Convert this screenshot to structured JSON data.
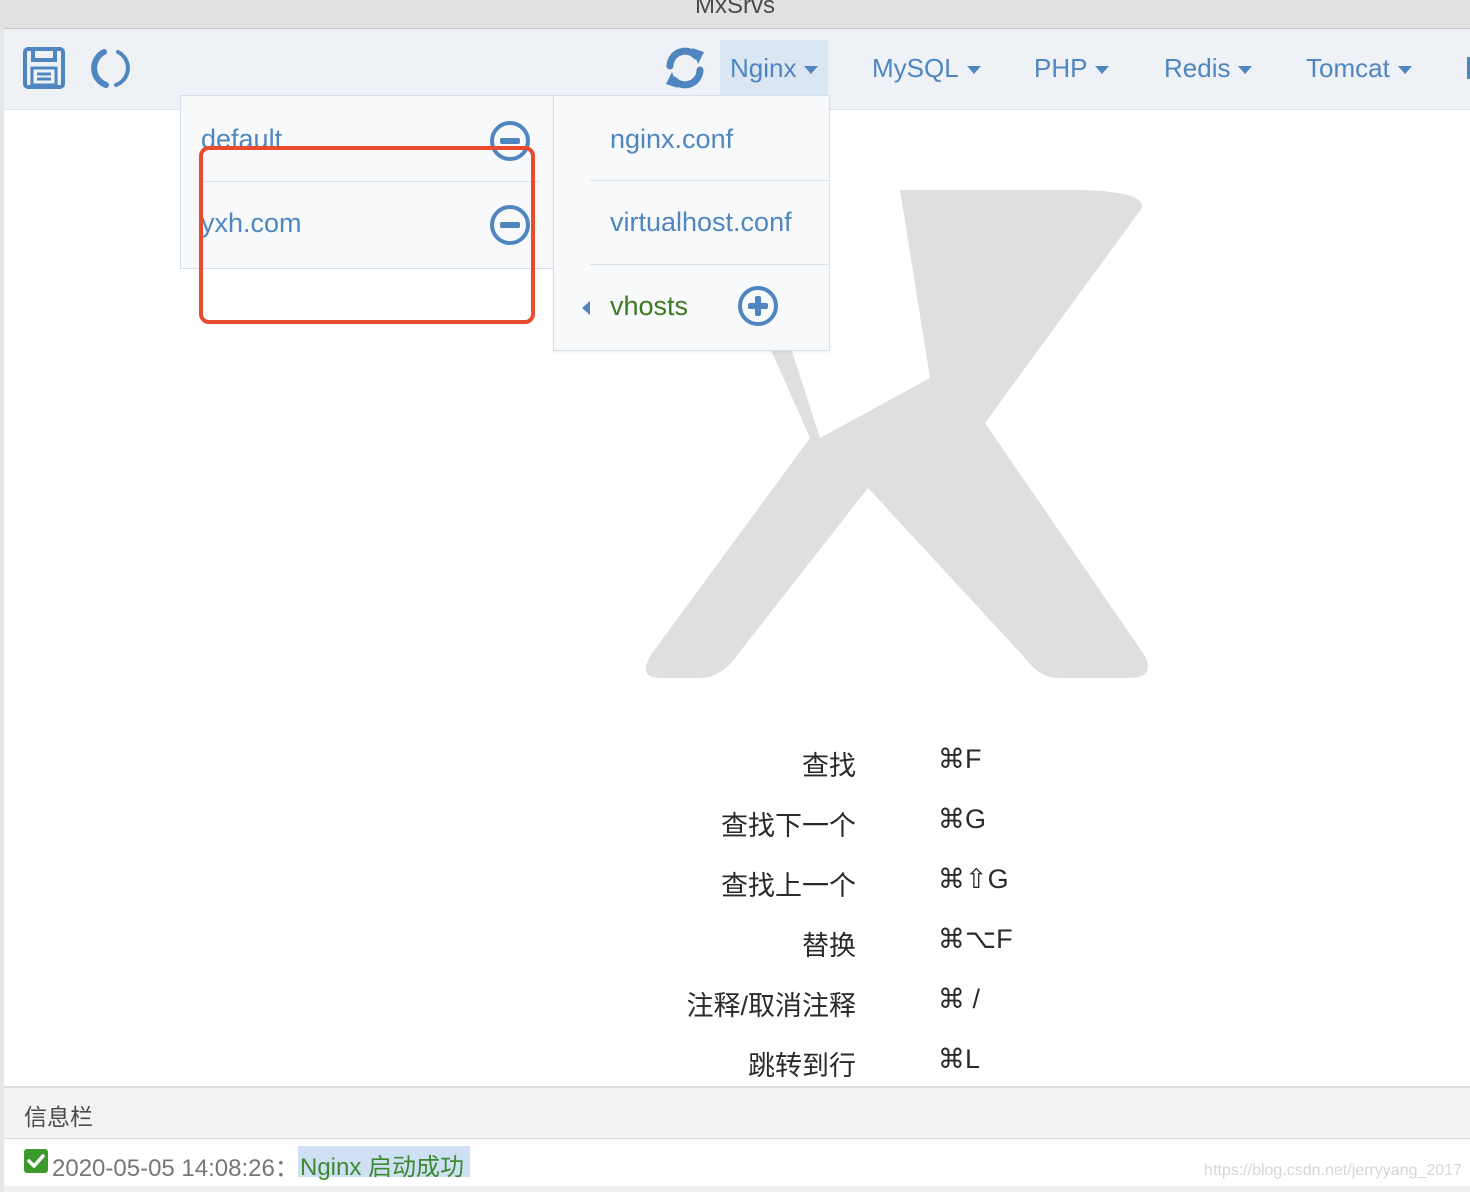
{
  "window": {
    "title": "MxSrvs"
  },
  "toolbar": {
    "icons": [
      "save-icon",
      "loading-ring-icon",
      "refresh-icon"
    ],
    "menus": [
      {
        "label": "Nginx",
        "active": true
      },
      {
        "label": "MySQL",
        "active": false
      },
      {
        "label": "PHP",
        "active": false
      },
      {
        "label": "Redis",
        "active": false
      },
      {
        "label": "Tomcat",
        "active": false
      }
    ]
  },
  "nginx_menu": {
    "files": [
      "nginx.conf",
      "virtualhost.conf"
    ],
    "vhosts_label": "vhosts",
    "vhosts": [
      {
        "name": "default"
      },
      {
        "name": "yxh.com"
      }
    ]
  },
  "shortcuts": [
    {
      "label": "查找",
      "key": "⌘F"
    },
    {
      "label": "查找下一个",
      "key": "⌘G"
    },
    {
      "label": "查找上一个",
      "key": "⌘⇧G"
    },
    {
      "label": "替换",
      "key": "⌘⌥F"
    },
    {
      "label": "注释/取消注释",
      "key": "⌘ /"
    },
    {
      "label": "跳转到行",
      "key": "⌘L"
    }
  ],
  "info_bar": {
    "title": "信息栏",
    "entries": [
      {
        "time": "2020-05-05 14:08:26：",
        "message": "Nginx 启动成功",
        "status": "success"
      }
    ]
  },
  "watermark": "https://blog.csdn.net/jerryyang_2017",
  "colors": {
    "accent": "#4f86bf",
    "success": "#3b8a2f",
    "highlight_box": "#e84b2e"
  }
}
